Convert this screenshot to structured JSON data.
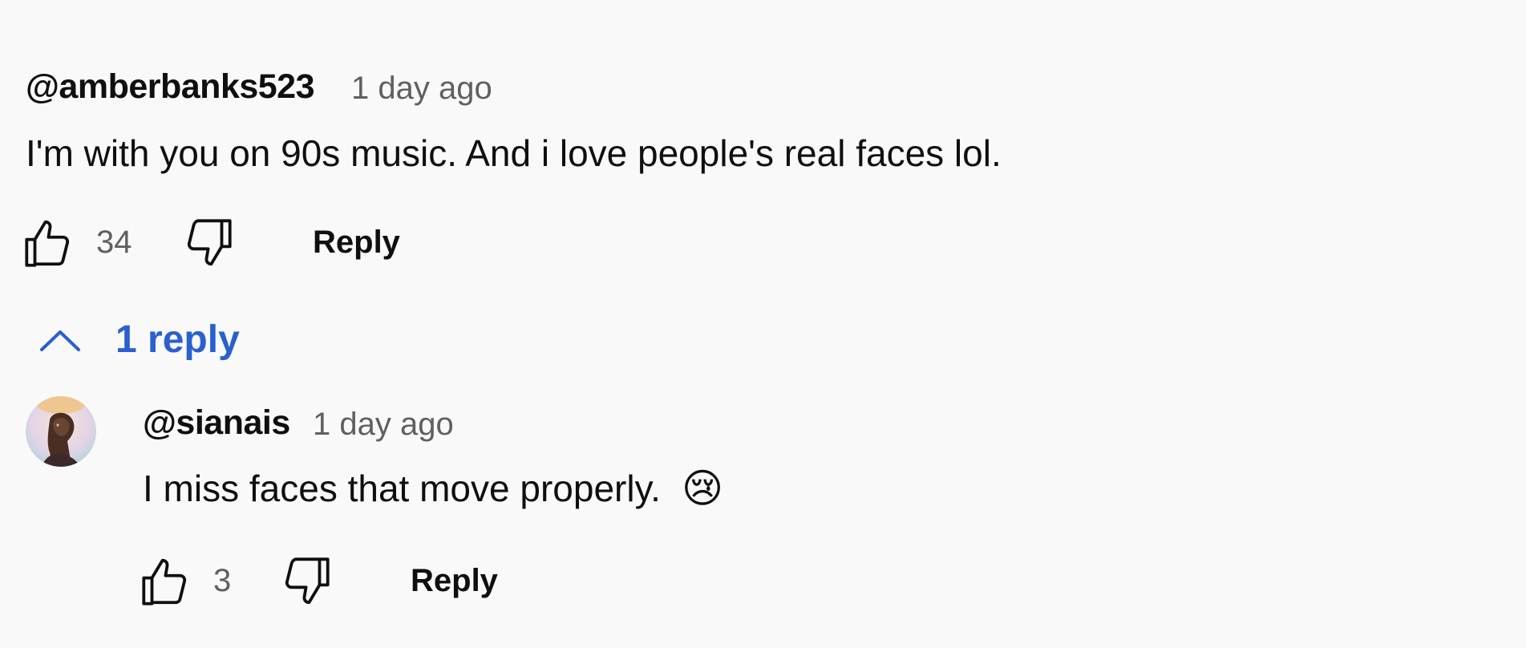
{
  "comment": {
    "author": "@amberbanks523",
    "time": "1 day ago",
    "text": "I'm with you on 90s music. And i love people's real faces lol.",
    "likes": "34",
    "reply_label": "Reply",
    "icons": {
      "like": "thumbs-up-icon",
      "dislike": "thumbs-down-icon"
    }
  },
  "replies_toggle": {
    "label": "1 reply",
    "icon": "chevron-up-icon",
    "color": "#2a5fd0"
  },
  "reply": {
    "author": "@sianais",
    "time": "1 day ago",
    "text": "I miss faces that move properly.",
    "emoji": "😢",
    "likes": "3",
    "reply_label": "Reply",
    "avatar": "avatar-illustration",
    "icons": {
      "like": "thumbs-up-icon",
      "dislike": "thumbs-down-icon"
    }
  }
}
